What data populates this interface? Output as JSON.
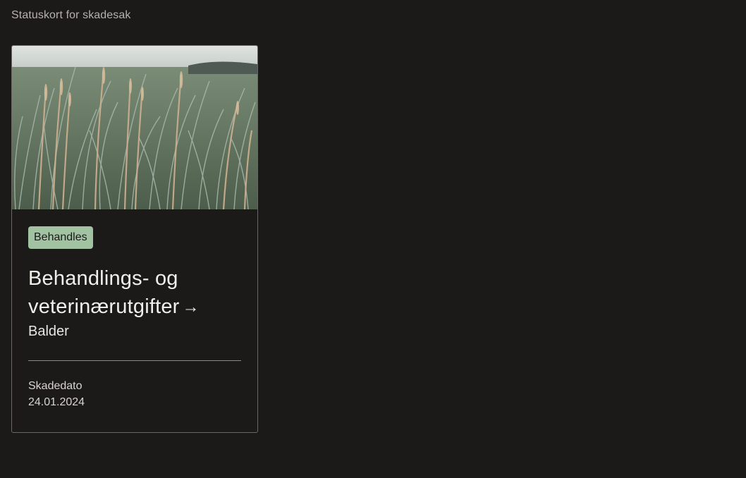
{
  "page": {
    "heading": "Statuskort for skadesak"
  },
  "card": {
    "image_alt": "grass-photo",
    "status": "Behandles",
    "title_line1": "Behandlings- og",
    "title_line2": "veterinærutgifter",
    "arrow": "→",
    "subtitle": "Balder",
    "meta_label": "Skadedato",
    "meta_value": "24.01.2024"
  },
  "colors": {
    "background": "#1b1a19",
    "badge": "#a1c3a2",
    "text": "#f1efea"
  }
}
